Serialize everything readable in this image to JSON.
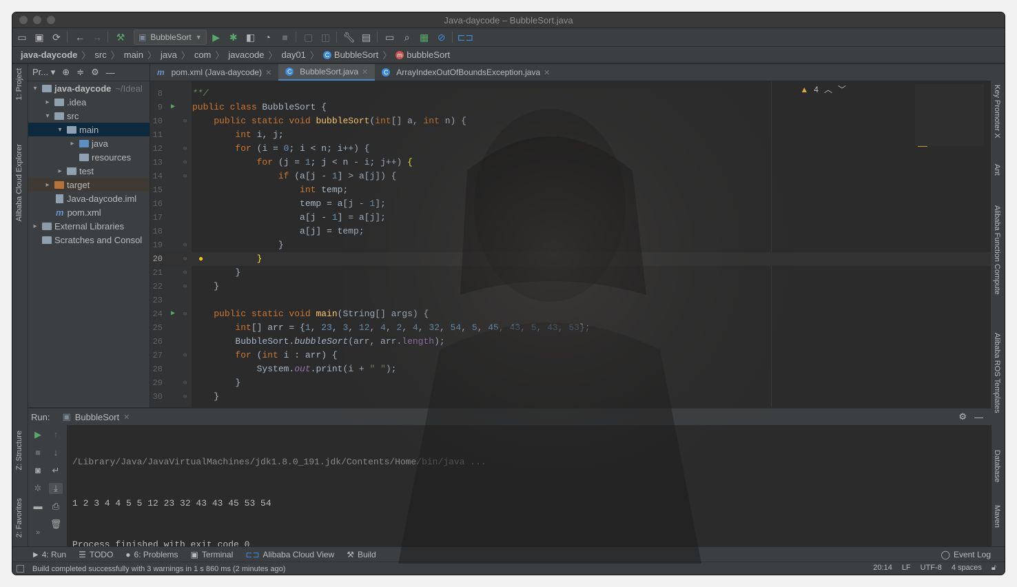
{
  "window": {
    "title": "Java-daycode – BubbleSort.java"
  },
  "toolbar": {
    "run_config": "BubbleSort"
  },
  "breadcrumb": [
    "java-daycode",
    "src",
    "main",
    "java",
    "com",
    "javacode",
    "day01",
    "BubbleSort",
    "bubbleSort"
  ],
  "left_strip": {
    "project": "1: Project",
    "cloud_explorer": "Alibaba Cloud Explorer",
    "structure": "Z: Structure",
    "favorites": "2: Favorites"
  },
  "right_strip": {
    "key_promoter": "Key Promoter X",
    "ant": "Ant",
    "function_compute": "Alibaba Function Compute",
    "ros_templates": "Alibaba ROS Templates",
    "database": "Database",
    "maven": "Maven"
  },
  "project": {
    "header": "Pr...",
    "root_name": "java-daycode",
    "root_path": "~/Ideal",
    "tree": [
      {
        "label": "java-daycode",
        "indent": 0
      },
      {
        "label": ".idea",
        "indent": 1
      },
      {
        "label": "src",
        "indent": 1
      },
      {
        "label": "main",
        "indent": 2
      },
      {
        "label": "java",
        "indent": 3
      },
      {
        "label": "resources",
        "indent": 3
      },
      {
        "label": "test",
        "indent": 2
      },
      {
        "label": "target",
        "indent": 1
      },
      {
        "label": "Java-daycode.iml",
        "indent": 1
      },
      {
        "label": "pom.xml",
        "indent": 1
      },
      {
        "label": "External Libraries",
        "indent": 0
      },
      {
        "label": "Scratches and Consol",
        "indent": 0
      }
    ]
  },
  "tabs": [
    {
      "label": "pom.xml (Java-daycode)",
      "active": false
    },
    {
      "label": "BubbleSort.java",
      "active": true
    },
    {
      "label": "ArrayIndexOutOfBoundsException.java",
      "active": false
    }
  ],
  "editor": {
    "warning_count": "4",
    "line_numbers": [
      "8",
      "9",
      "10",
      "11",
      "12",
      "13",
      "14",
      "15",
      "16",
      "17",
      "18",
      "19",
      "20",
      "21",
      "22",
      "23",
      "24",
      "25",
      "26",
      "27",
      "28",
      "29",
      "30"
    ],
    "current_line": "20"
  },
  "run": {
    "label": "Run:",
    "config": "BubbleSort",
    "output": [
      "/Library/Java/JavaVirtualMachines/jdk1.8.0_191.jdk/Contents/Home/bin/java ...",
      "1 2 3 4 4 5 5 12 23 32 43 43 45 53 54",
      "Process finished with exit code 0"
    ]
  },
  "bottom_tabs": [
    {
      "label": "4: Run",
      "icon": "play-icon"
    },
    {
      "label": "TODO",
      "icon": "list-icon"
    },
    {
      "label": "6: Problems",
      "icon": "info-icon"
    },
    {
      "label": "Terminal",
      "icon": "terminal-icon"
    },
    {
      "label": "Alibaba Cloud View",
      "icon": "cloud-icon"
    },
    {
      "label": "Build",
      "icon": "hammer-icon"
    }
  ],
  "event_log": "Event Log",
  "status": {
    "message": "Build completed successfully with 3 warnings in 1 s 860 ms (2 minutes ago)",
    "position": "20:14",
    "line_sep": "LF",
    "encoding": "UTF-8",
    "indent": "4 spaces"
  },
  "colors": {
    "keyword": "#cc7832",
    "number": "#6897bb",
    "method": "#ffc66d",
    "string": "#6a8759",
    "field": "#9876aa",
    "accent": "#4a88c7"
  }
}
